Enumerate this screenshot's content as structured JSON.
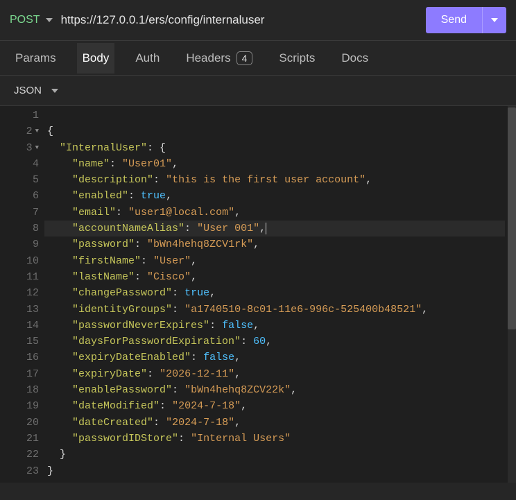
{
  "request": {
    "method": "POST",
    "url": "https://127.0.0.1/ers/config/internaluser",
    "send_label": "Send"
  },
  "tabs": {
    "items": [
      {
        "label": "Params",
        "active": false
      },
      {
        "label": "Body",
        "active": true
      },
      {
        "label": "Auth",
        "active": false
      },
      {
        "label": "Headers",
        "active": false,
        "badge": "4"
      },
      {
        "label": "Scripts",
        "active": false
      },
      {
        "label": "Docs",
        "active": false
      }
    ]
  },
  "body_type": {
    "label": "JSON"
  },
  "editor": {
    "lines": [
      {
        "n": 1,
        "tokens": [
          {
            "t": "",
            "c": "p"
          }
        ]
      },
      {
        "n": 2,
        "fold": true,
        "tokens": [
          {
            "t": "{",
            "c": "p"
          }
        ]
      },
      {
        "n": 3,
        "fold": true,
        "tokens": [
          {
            "t": "  ",
            "c": "p"
          },
          {
            "t": "\"InternalUser\"",
            "c": "k"
          },
          {
            "t": ": {",
            "c": "p"
          }
        ]
      },
      {
        "n": 4,
        "tokens": [
          {
            "t": "    ",
            "c": "p"
          },
          {
            "t": "\"name\"",
            "c": "k"
          },
          {
            "t": ": ",
            "c": "p"
          },
          {
            "t": "\"User01\"",
            "c": "s"
          },
          {
            "t": ",",
            "c": "p"
          }
        ]
      },
      {
        "n": 5,
        "tokens": [
          {
            "t": "    ",
            "c": "p"
          },
          {
            "t": "\"description\"",
            "c": "k"
          },
          {
            "t": ": ",
            "c": "p"
          },
          {
            "t": "\"this is the first user account\"",
            "c": "s"
          },
          {
            "t": ",",
            "c": "p"
          }
        ]
      },
      {
        "n": 6,
        "tokens": [
          {
            "t": "    ",
            "c": "p"
          },
          {
            "t": "\"enabled\"",
            "c": "k"
          },
          {
            "t": ": ",
            "c": "p"
          },
          {
            "t": "true",
            "c": "b"
          },
          {
            "t": ",",
            "c": "p"
          }
        ]
      },
      {
        "n": 7,
        "tokens": [
          {
            "t": "    ",
            "c": "p"
          },
          {
            "t": "\"email\"",
            "c": "k"
          },
          {
            "t": ": ",
            "c": "p"
          },
          {
            "t": "\"user1@local.com\"",
            "c": "s"
          },
          {
            "t": ",",
            "c": "p"
          }
        ]
      },
      {
        "n": 8,
        "highlight": true,
        "tokens": [
          {
            "t": "    ",
            "c": "p"
          },
          {
            "t": "\"accountNameAlias\"",
            "c": "k"
          },
          {
            "t": ": ",
            "c": "p"
          },
          {
            "t": "\"User 001\"",
            "c": "s"
          },
          {
            "t": ",",
            "c": "p"
          }
        ],
        "cursor": true
      },
      {
        "n": 9,
        "tokens": [
          {
            "t": "    ",
            "c": "p"
          },
          {
            "t": "\"password\"",
            "c": "k"
          },
          {
            "t": ": ",
            "c": "p"
          },
          {
            "t": "\"bWn4hehq8ZCV1rk\"",
            "c": "s"
          },
          {
            "t": ",",
            "c": "p"
          }
        ]
      },
      {
        "n": 10,
        "tokens": [
          {
            "t": "    ",
            "c": "p"
          },
          {
            "t": "\"firstName\"",
            "c": "k"
          },
          {
            "t": ": ",
            "c": "p"
          },
          {
            "t": "\"User\"",
            "c": "s"
          },
          {
            "t": ",",
            "c": "p"
          }
        ]
      },
      {
        "n": 11,
        "tokens": [
          {
            "t": "    ",
            "c": "p"
          },
          {
            "t": "\"lastName\"",
            "c": "k"
          },
          {
            "t": ": ",
            "c": "p"
          },
          {
            "t": "\"Cisco\"",
            "c": "s"
          },
          {
            "t": ",",
            "c": "p"
          }
        ]
      },
      {
        "n": 12,
        "tokens": [
          {
            "t": "    ",
            "c": "p"
          },
          {
            "t": "\"changePassword\"",
            "c": "k"
          },
          {
            "t": ": ",
            "c": "p"
          },
          {
            "t": "true",
            "c": "b"
          },
          {
            "t": ",",
            "c": "p"
          }
        ]
      },
      {
        "n": 13,
        "tokens": [
          {
            "t": "    ",
            "c": "p"
          },
          {
            "t": "\"identityGroups\"",
            "c": "k"
          },
          {
            "t": ": ",
            "c": "p"
          },
          {
            "t": "\"a1740510-8c01-11e6-996c-525400b48521\"",
            "c": "s"
          },
          {
            "t": ",",
            "c": "p"
          }
        ]
      },
      {
        "n": 14,
        "tokens": [
          {
            "t": "    ",
            "c": "p"
          },
          {
            "t": "\"passwordNeverExpires\"",
            "c": "k"
          },
          {
            "t": ": ",
            "c": "p"
          },
          {
            "t": "false",
            "c": "b"
          },
          {
            "t": ",",
            "c": "p"
          }
        ]
      },
      {
        "n": 15,
        "tokens": [
          {
            "t": "    ",
            "c": "p"
          },
          {
            "t": "\"daysForPasswordExpiration\"",
            "c": "k"
          },
          {
            "t": ": ",
            "c": "p"
          },
          {
            "t": "60",
            "c": "n"
          },
          {
            "t": ",",
            "c": "p"
          }
        ]
      },
      {
        "n": 16,
        "tokens": [
          {
            "t": "    ",
            "c": "p"
          },
          {
            "t": "\"expiryDateEnabled\"",
            "c": "k"
          },
          {
            "t": ": ",
            "c": "p"
          },
          {
            "t": "false",
            "c": "b"
          },
          {
            "t": ",",
            "c": "p"
          }
        ]
      },
      {
        "n": 17,
        "tokens": [
          {
            "t": "    ",
            "c": "p"
          },
          {
            "t": "\"expiryDate\"",
            "c": "k"
          },
          {
            "t": ": ",
            "c": "p"
          },
          {
            "t": "\"2026-12-11\"",
            "c": "s"
          },
          {
            "t": ",",
            "c": "p"
          }
        ]
      },
      {
        "n": 18,
        "tokens": [
          {
            "t": "    ",
            "c": "p"
          },
          {
            "t": "\"enablePassword\"",
            "c": "k"
          },
          {
            "t": ": ",
            "c": "p"
          },
          {
            "t": "\"bWn4hehq8ZCV22k\"",
            "c": "s"
          },
          {
            "t": ",",
            "c": "p"
          }
        ]
      },
      {
        "n": 19,
        "tokens": [
          {
            "t": "    ",
            "c": "p"
          },
          {
            "t": "\"dateModified\"",
            "c": "k"
          },
          {
            "t": ": ",
            "c": "p"
          },
          {
            "t": "\"2024-7-18\"",
            "c": "s"
          },
          {
            "t": ",",
            "c": "p"
          }
        ]
      },
      {
        "n": 20,
        "tokens": [
          {
            "t": "    ",
            "c": "p"
          },
          {
            "t": "\"dateCreated\"",
            "c": "k"
          },
          {
            "t": ": ",
            "c": "p"
          },
          {
            "t": "\"2024-7-18\"",
            "c": "s"
          },
          {
            "t": ",",
            "c": "p"
          }
        ]
      },
      {
        "n": 21,
        "tokens": [
          {
            "t": "    ",
            "c": "p"
          },
          {
            "t": "\"passwordIDStore\"",
            "c": "k"
          },
          {
            "t": ": ",
            "c": "p"
          },
          {
            "t": "\"Internal Users\"",
            "c": "s"
          }
        ]
      },
      {
        "n": 22,
        "tokens": [
          {
            "t": "  }",
            "c": "p"
          }
        ]
      },
      {
        "n": 23,
        "tokens": [
          {
            "t": "}",
            "c": "p"
          }
        ]
      }
    ]
  }
}
